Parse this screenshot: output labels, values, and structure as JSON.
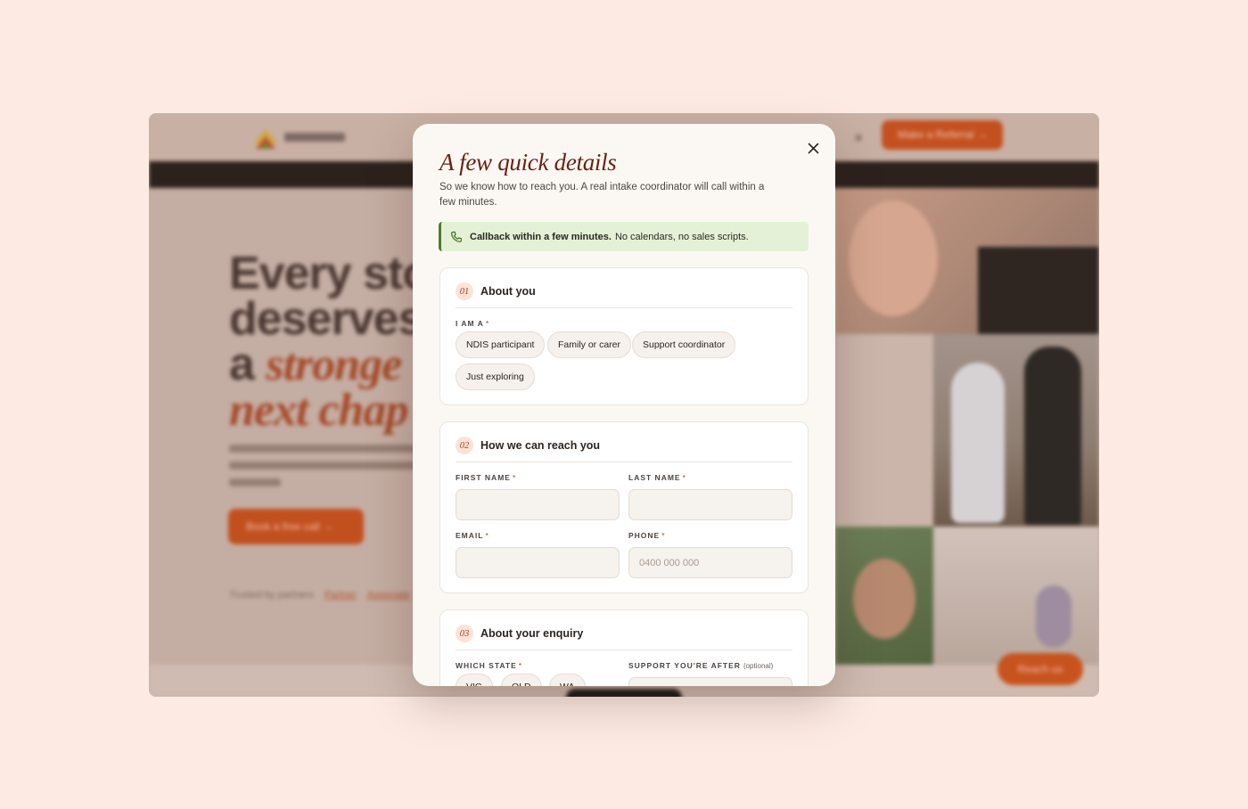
{
  "background": {
    "nav": {
      "cta_label": "Make a Referral →",
      "menu_glyph": "≡"
    },
    "hero": {
      "headline_line1": "Every stor",
      "headline_line2": "deserves",
      "headline_line3_plain": "a ",
      "headline_line3_italic": "stronge",
      "headline_line4_italic": "next chap",
      "cta_label": "Book a free call →",
      "small_text": "Trusted by partners",
      "small_links": [
        "Partner",
        "Associate"
      ]
    },
    "reach_us_label": "Reach us"
  },
  "modal": {
    "title": "A few quick details",
    "subtitle": "So we know how to reach you. A real intake coordinator will call within a few minutes.",
    "callout": {
      "bold": "Callback within a few minutes.",
      "text": "No calendars, no sales scripts.",
      "icon": "phone-icon"
    },
    "close_icon": "close-icon",
    "sections": [
      {
        "number": "01",
        "title": "About you",
        "field_label": "I AM A",
        "required_mark": "*",
        "options": [
          "NDIS participant",
          "Family or carer",
          "Support coordinator",
          "Just exploring"
        ]
      },
      {
        "number": "02",
        "title": "How we can reach you",
        "fields": {
          "first_name": {
            "label": "FIRST NAME",
            "required_mark": "*",
            "value": "",
            "placeholder": ""
          },
          "last_name": {
            "label": "LAST NAME",
            "required_mark": "*",
            "value": "",
            "placeholder": ""
          },
          "email": {
            "label": "EMAIL",
            "required_mark": "*",
            "value": "",
            "placeholder": ""
          },
          "phone": {
            "label": "PHONE",
            "required_mark": "*",
            "value": "",
            "placeholder": "0400 000 000"
          }
        }
      },
      {
        "number": "03",
        "title": "About your enquiry",
        "state_label": "WHICH STATE",
        "state_required_mark": "*",
        "states": [
          "VIC",
          "QLD",
          "WA"
        ],
        "support_label": "SUPPORT YOU'RE AFTER",
        "support_optional": "(optional)"
      }
    ]
  },
  "colors": {
    "accent": "#6b1f10",
    "brand_orange": "#c8531e",
    "callout_bg": "#e4f1d6",
    "callout_border": "#4f7c2c",
    "backdrop": "#fdebe3"
  }
}
